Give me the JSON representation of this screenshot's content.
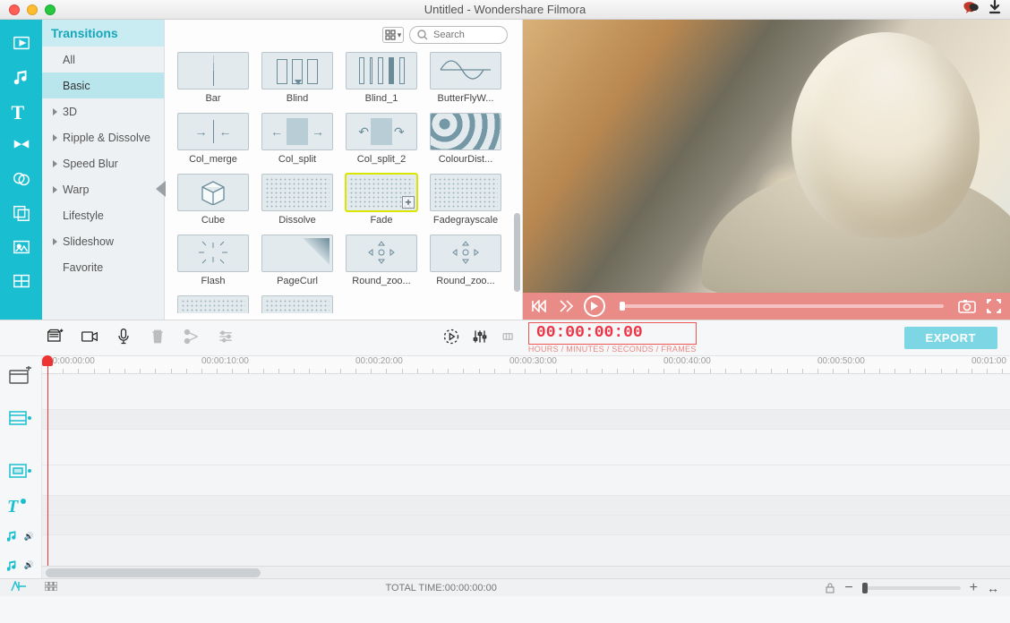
{
  "titlebar": {
    "title": "Untitled - Wondershare Filmora"
  },
  "sidebar_tools": [
    {
      "name": "media-icon"
    },
    {
      "name": "music-icon"
    },
    {
      "name": "text-icon"
    },
    {
      "name": "transitions-icon"
    },
    {
      "name": "filters-icon"
    },
    {
      "name": "overlays-icon"
    },
    {
      "name": "elements-icon"
    },
    {
      "name": "splitscreen-icon"
    }
  ],
  "categories": {
    "header": "Transitions",
    "items": [
      {
        "label": "All",
        "expandable": false
      },
      {
        "label": "Basic",
        "expandable": false,
        "selected": true
      },
      {
        "label": "3D",
        "expandable": true
      },
      {
        "label": "Ripple & Dissolve",
        "expandable": true
      },
      {
        "label": "Speed Blur",
        "expandable": true
      },
      {
        "label": "Warp",
        "expandable": true
      },
      {
        "label": "Lifestyle",
        "expandable": false
      },
      {
        "label": "Slideshow",
        "expandable": true
      },
      {
        "label": "Favorite",
        "expandable": false
      }
    ]
  },
  "grid": {
    "search_placeholder": "Search",
    "thumbs": [
      {
        "label": "Bar",
        "cls": "th-bar"
      },
      {
        "label": "Blind",
        "cls": "th-blind"
      },
      {
        "label": "Blind_1",
        "cls": "th-blind1"
      },
      {
        "label": "ButterFlyW...",
        "cls": "th-bfly"
      },
      {
        "label": "Col_merge",
        "cls": "th-merge"
      },
      {
        "label": "Col_split",
        "cls": "th-split"
      },
      {
        "label": "Col_split_2",
        "cls": "th-split2"
      },
      {
        "label": "ColourDist...",
        "cls": "th-colour"
      },
      {
        "label": "Cube",
        "cls": "th-cube"
      },
      {
        "label": "Dissolve",
        "cls": "th-dots"
      },
      {
        "label": "Fade",
        "cls": "th-fade",
        "selected": true,
        "plus": true
      },
      {
        "label": "Fadegrayscale",
        "cls": "th-dots"
      },
      {
        "label": "Flash",
        "cls": "th-flash"
      },
      {
        "label": "PageCurl",
        "cls": "th-curl"
      },
      {
        "label": "Round_zoo...",
        "cls": "th-round"
      },
      {
        "label": "Round_zoo...",
        "cls": "th-round"
      }
    ]
  },
  "editor": {
    "timecode": "00:00:00:00",
    "timecode_label": "HOURS / MINUTES / SECONDS / FRAMES",
    "export_label": "EXPORT",
    "ruler": [
      "00:00:00:00",
      "00:00:10:00",
      "00:00:20:00",
      "00:00:30:00",
      "00:00:40:00",
      "00:00:50:00",
      "00:01:00"
    ]
  },
  "status": {
    "total_label": "TOTAL TIME:",
    "total_value": "00:00:00:00"
  }
}
